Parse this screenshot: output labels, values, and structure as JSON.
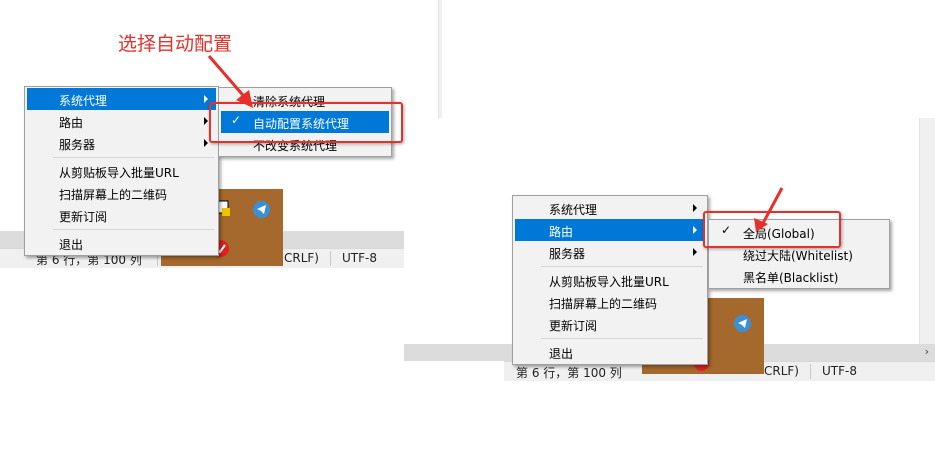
{
  "annotation": {
    "text": "选择自动配置"
  },
  "status": {
    "position": "第 6 行，第 100 列",
    "line_ending": "CRLF)",
    "encoding": "UTF-8"
  },
  "main_menu": {
    "items": [
      {
        "label": "系统代理"
      },
      {
        "label": "路由"
      },
      {
        "label": "服务器"
      },
      {
        "label": "从剪贴板导入批量URL"
      },
      {
        "label": "扫描屏幕上的二维码"
      },
      {
        "label": "更新订阅"
      },
      {
        "label": "退出"
      }
    ]
  },
  "proxy_submenu": {
    "items": [
      {
        "label": "清除系统代理"
      },
      {
        "label": "自动配置系统代理",
        "checked": true
      },
      {
        "label": "不改变系统代理"
      }
    ]
  },
  "route_submenu": {
    "items": [
      {
        "label": "全局(Global)",
        "checked": true
      },
      {
        "label": "绕过大陆(Whitelist)"
      },
      {
        "label": "黑名单(Blacklist)"
      }
    ]
  },
  "check_mark": "✓",
  "colors": {
    "highlight": "#0078d7",
    "annotation_red": "#e8302a",
    "tray_bg": "#a5692d"
  },
  "icons": {
    "telegram": "telegram-icon",
    "arrow": "red-arrow-icon",
    "shield": "shield-icon",
    "stop": "stop-icon"
  }
}
